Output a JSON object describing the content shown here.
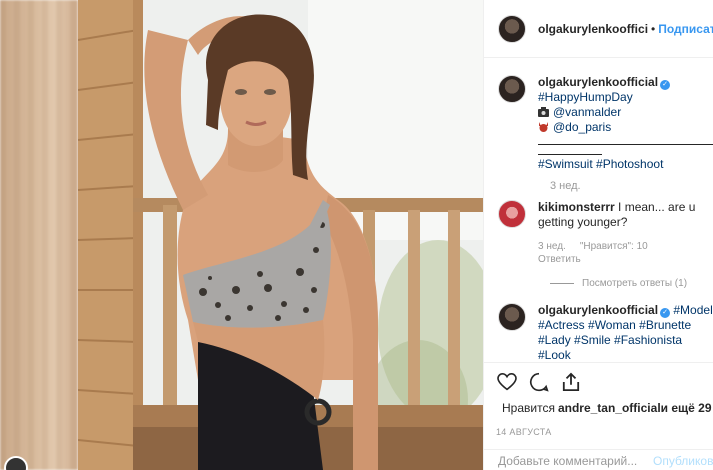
{
  "header": {
    "username": "olgakurylenkooffici",
    "separator": "•",
    "follow": "Подписаться"
  },
  "comments": [
    {
      "username": "olgakurylenkoofficial",
      "verified": true,
      "hashtag1": "#HappyHumpDay",
      "mention1": "@vanmalder",
      "mention2": "@do_paris",
      "hashtags2": "#Swimsuit #Photoshoot",
      "age": "3 нед."
    },
    {
      "username": "kikimonsterrr",
      "text": " I mean... are u getting younger?",
      "age": "3 нед.",
      "likes": "\"Нравится\": 10",
      "reply": "Ответить",
      "view_replies": "Посмотреть ответы (1)"
    },
    {
      "username": "olgakurylenkoofficial",
      "verified": true,
      "hashtags": "#Model #Actress #Woman #Brunette #Lady #Smile #Fashionista #Look"
    }
  ],
  "icons": [
    "heart-icon",
    "comment-icon",
    "share-icon"
  ],
  "likes": {
    "prefix": "Нравится ",
    "user": "andre_tan_official",
    "suffix": " и ещё 29"
  },
  "date": "14 АВГУСТА",
  "add_comment": {
    "placeholder": "Добавьте комментарий...",
    "publish": "Опубликовать"
  },
  "colors": {
    "link": "#003569",
    "accent": "#3897f0",
    "muted": "#999999",
    "publish_disabled": "#b2dffc"
  }
}
